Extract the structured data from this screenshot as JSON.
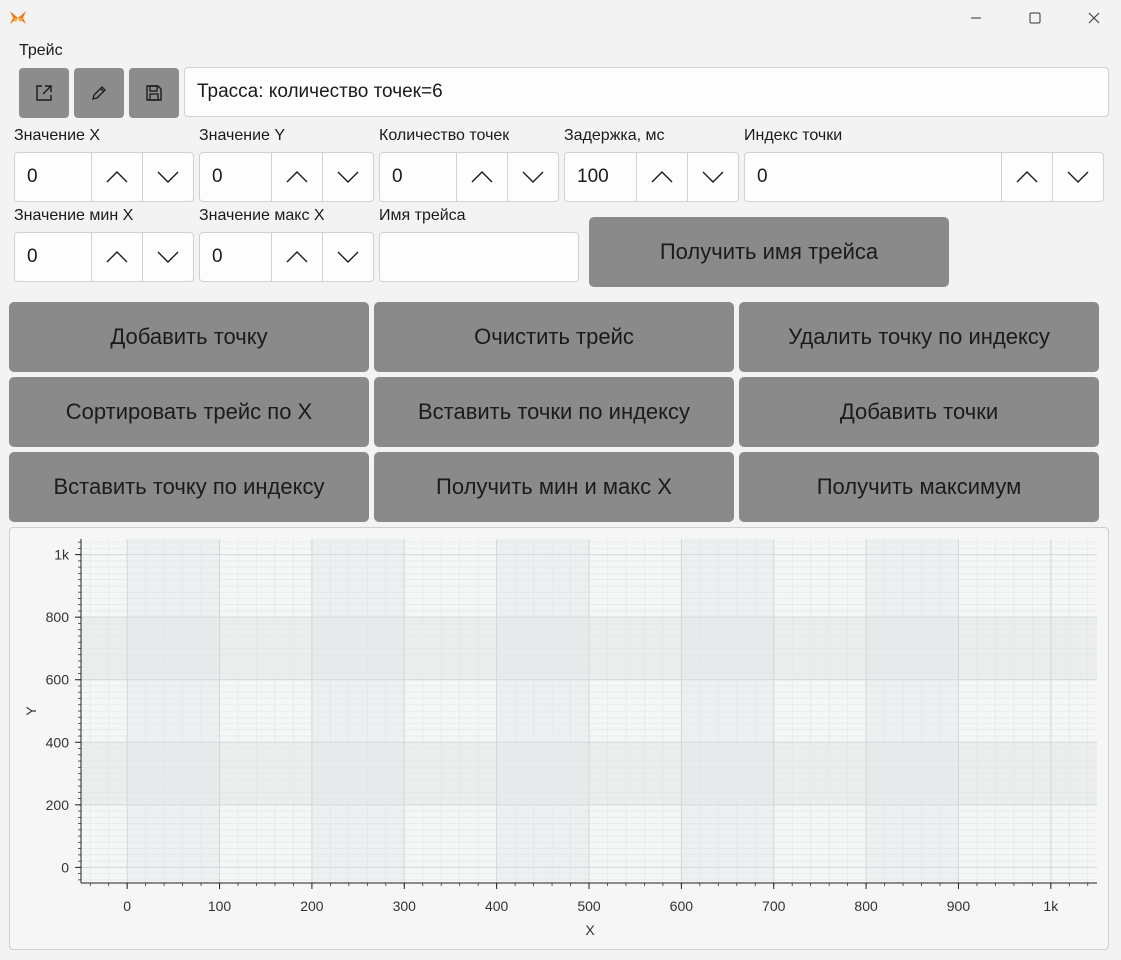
{
  "window": {
    "logo_icon": "butterfly-logo-icon",
    "controls": [
      "minimize-icon",
      "maximize-icon",
      "close-icon"
    ]
  },
  "trace": {
    "section_label": "Трейс",
    "info_text": "Трасса: количество точек=6",
    "toolbar_icons": [
      "open-external-icon",
      "edit-pencil-icon",
      "save-disk-icon"
    ]
  },
  "fields": {
    "x_value": {
      "label": "Значение X",
      "value": "0"
    },
    "y_value": {
      "label": "Значение Y",
      "value": "0"
    },
    "points_count": {
      "label": "Количество точек",
      "value": "0"
    },
    "delay": {
      "label": "Задержка, мс",
      "value": "100"
    },
    "point_index": {
      "label": "Индекс точки",
      "value": "0"
    },
    "x_min": {
      "label": "Значение мин X",
      "value": "0"
    },
    "x_max": {
      "label": "Значение макс X",
      "value": "0"
    },
    "trace_name": {
      "label": "Имя трейса",
      "value": ""
    }
  },
  "buttons": {
    "get_trace_name": "Получить имя трейса",
    "add_point": "Добавить точку",
    "clear_trace": "Очистить трейс",
    "delete_point_by_index": "Удалить точку по индексу",
    "sort_trace_by_x": "Сортировать трейс по X",
    "insert_points_by_index": "Вставить точки по индексу",
    "add_points": "Добавить точки",
    "insert_point_by_index": "Вставить точку по индексу",
    "get_min_max_x": "Получить мин и макс X",
    "get_maximum": "Получить максимум"
  },
  "chart_data": {
    "type": "scatter",
    "title": "",
    "xlabel": "X",
    "ylabel": "Y",
    "xlim": [
      -50,
      1050
    ],
    "ylim": [
      -50,
      1050
    ],
    "x_ticks": [
      0,
      100,
      200,
      300,
      400,
      500,
      600,
      700,
      800,
      900,
      1000
    ],
    "x_tick_labels": [
      "0",
      "100",
      "200",
      "300",
      "400",
      "500",
      "600",
      "700",
      "800",
      "900",
      "1k"
    ],
    "y_ticks": [
      0,
      200,
      400,
      600,
      800,
      1000
    ],
    "y_tick_labels": [
      "0",
      "200",
      "400",
      "600",
      "800",
      "1k"
    ],
    "grid": true,
    "series": []
  }
}
